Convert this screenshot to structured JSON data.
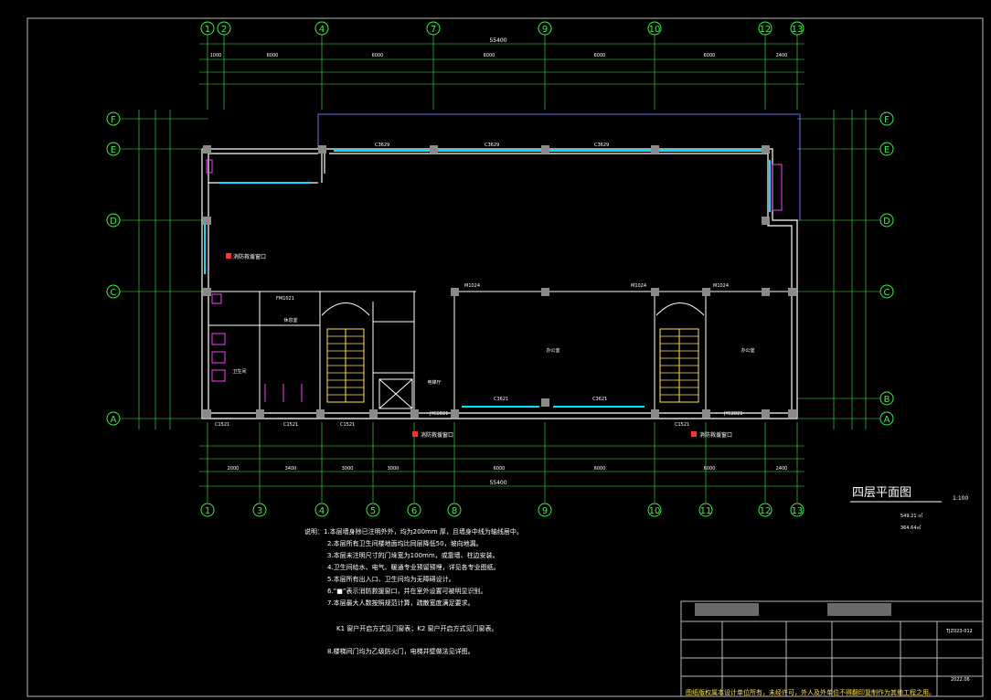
{
  "colors": {
    "background": "#000000",
    "axis": "#3cf04a",
    "wall": "#ffffff",
    "window": "#00e5ff",
    "column": "#8a8a8a",
    "stair": "#ffe34d",
    "accent_red": "#ff3030",
    "dim": "#3cf04a",
    "border": "#b7b7b7",
    "facade": "#7070ff",
    "magenta": "#ff3cff"
  },
  "axes": {
    "top": [
      "1",
      "2",
      "4",
      "7",
      "9",
      "10",
      "12",
      "13"
    ],
    "bottom": [
      "1",
      "3",
      "4",
      "5",
      "6",
      "8",
      "9",
      "10",
      "11",
      "12",
      "13"
    ],
    "left": [
      "F",
      "E",
      "D",
      "C",
      "A"
    ],
    "right": [
      "F",
      "E",
      "D",
      "C",
      "B",
      "A"
    ]
  },
  "dims": {
    "top_total": "55400",
    "top_row": [
      "1000",
      "6000",
      "6000",
      "6000",
      "6000",
      "6000",
      "2400"
    ],
    "bottom_total": "55400",
    "bottom_row": [
      "2000",
      "3400",
      "3000",
      "3000",
      "6000",
      "6000",
      "6000",
      "2400"
    ]
  },
  "labels": {
    "fire_window_1": "消防救援窗口",
    "fire_window_2": "消防救援窗口",
    "fire_window_3": "消防救援窗口",
    "window_codes": [
      "C3629",
      "C3629",
      "C3629",
      "C1521",
      "C1521",
      "C1521",
      "C3621",
      "C3621",
      "C1521",
      "JYC2821",
      "JYC2821"
    ],
    "door_codes": [
      "M1024",
      "M1024",
      "M1024",
      "FM1021"
    ],
    "room_1": "办公室",
    "room_2": "办公室",
    "room_3": "休息室",
    "room_4": "卫生间",
    "room_5": "电梯厅"
  },
  "title_block": {
    "title": "四层平面图",
    "scale": "1:100",
    "stats": [
      "549.21 ㎡",
      "364.64㎡"
    ],
    "tag": "TJZ023-012",
    "date": "2022.06"
  },
  "notes": [
    "说明：1.本层墙身除已注明外外，均为200mm 厚，且墙身中线为轴线居中。",
    "2.本层所有卫生间楼地面均比同层降低50，坡向地漏。",
    "3.本层未注明尺寸的门垛宽为100mm，或靠墙、柱边安装。",
    "4.卫生间给水、电气、暖通专业预留预埋，详见各专业图纸。",
    "5.本层所有出入口、卫生间均为无障碍设计。",
    "6.“■”表示消防救援窗口，并在室外设置可被明显识别。",
    "7.本层最大人数按照规范计算，疏散宽度满足要求。",
    "K1 窗户开启方式见门窗表；K2 窗户开启方式见门窗表。",
    "8.楼梯间门均为乙级防火门，电梯井壁做法见详图。"
  ],
  "footer": "图纸版权属本设计单位所有，未经许可，外人及外单位不得翻印复制作为其他工程之用。"
}
